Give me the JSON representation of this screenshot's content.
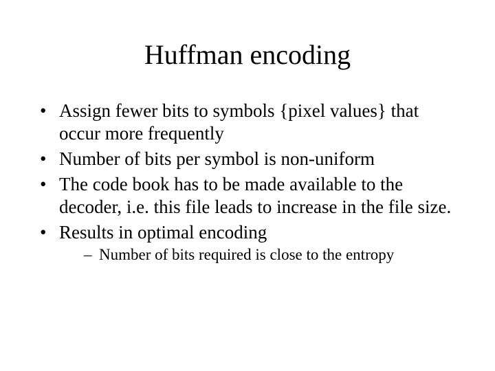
{
  "title": "Huffman encoding",
  "bullets": [
    "Assign fewer bits to symbols {pixel values} that occur more frequently",
    "Number of bits per symbol is non-uniform",
    "The code book has to be made available to the decoder, i.e. this file leads to increase in the file size.",
    "Results in optimal encoding"
  ],
  "subbullets": [
    "Number of bits required is close to the entropy"
  ]
}
